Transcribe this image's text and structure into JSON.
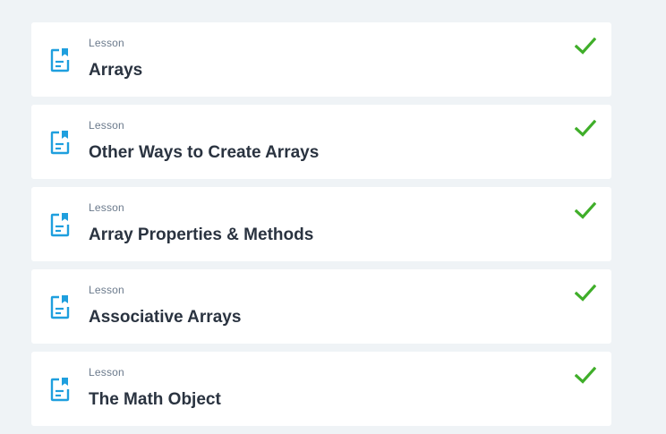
{
  "colors": {
    "background": "#eff3f6",
    "card": "#ffffff",
    "icon_blue": "#1f9fde",
    "check_green": "#3fae29",
    "title_text": "#2a3340",
    "label_text": "#6b7a8c"
  },
  "lessons": [
    {
      "type_label": "Lesson",
      "title": "Arrays",
      "icon": "lesson-document-icon",
      "status": "complete",
      "status_icon": "check-icon"
    },
    {
      "type_label": "Lesson",
      "title": "Other Ways to Create Arrays",
      "icon": "lesson-document-icon",
      "status": "complete",
      "status_icon": "check-icon"
    },
    {
      "type_label": "Lesson",
      "title": "Array Properties & Methods",
      "icon": "lesson-document-icon",
      "status": "complete",
      "status_icon": "check-icon"
    },
    {
      "type_label": "Lesson",
      "title": "Associative Arrays",
      "icon": "lesson-document-icon",
      "status": "complete",
      "status_icon": "check-icon"
    },
    {
      "type_label": "Lesson",
      "title": "The Math Object",
      "icon": "lesson-document-icon",
      "status": "complete",
      "status_icon": "check-icon"
    }
  ]
}
